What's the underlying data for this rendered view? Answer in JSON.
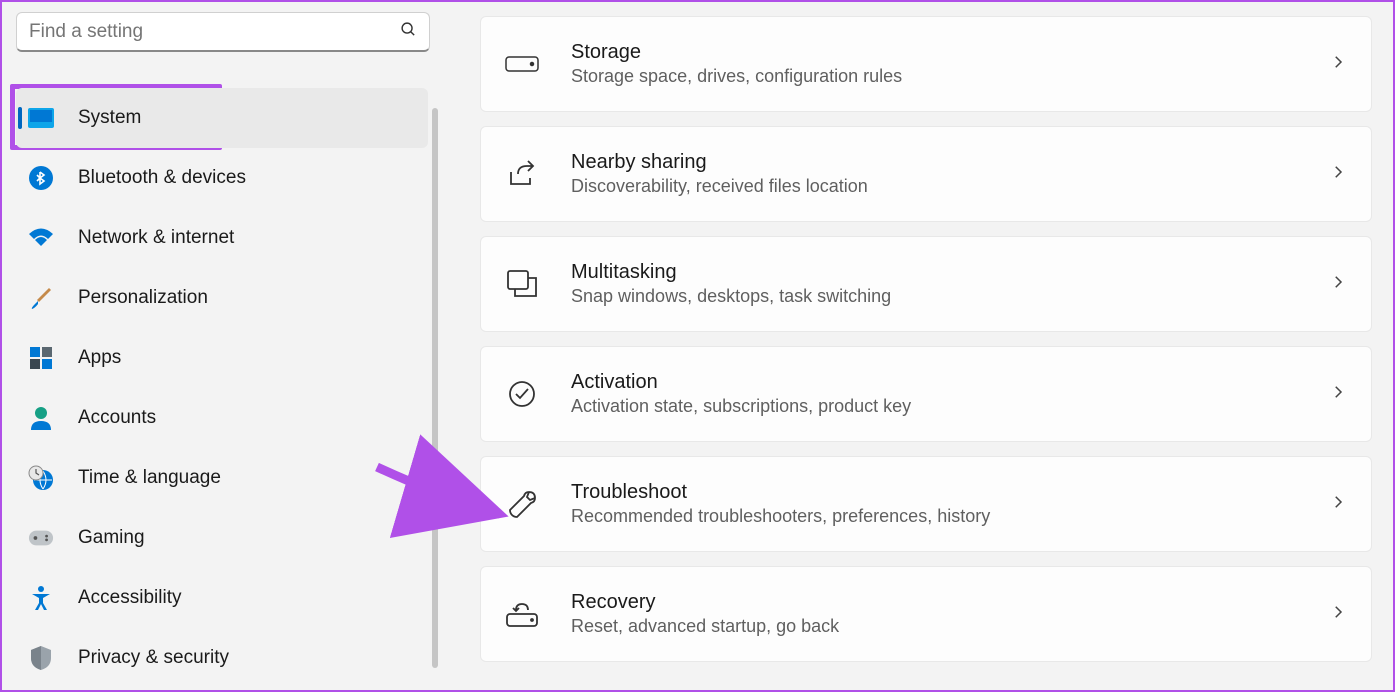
{
  "search": {
    "placeholder": "Find a setting"
  },
  "sidebar": {
    "items": [
      {
        "label": "System",
        "icon": "monitor",
        "selected": true
      },
      {
        "label": "Bluetooth & devices",
        "icon": "bluetooth"
      },
      {
        "label": "Network & internet",
        "icon": "wifi"
      },
      {
        "label": "Personalization",
        "icon": "brush"
      },
      {
        "label": "Apps",
        "icon": "apps"
      },
      {
        "label": "Accounts",
        "icon": "person"
      },
      {
        "label": "Time & language",
        "icon": "clock-globe"
      },
      {
        "label": "Gaming",
        "icon": "gamepad"
      },
      {
        "label": "Accessibility",
        "icon": "accessibility"
      },
      {
        "label": "Privacy & security",
        "icon": "shield"
      }
    ]
  },
  "cards": [
    {
      "title": "Storage",
      "sub": "Storage space, drives, configuration rules",
      "icon": "drive"
    },
    {
      "title": "Nearby sharing",
      "sub": "Discoverability, received files location",
      "icon": "share"
    },
    {
      "title": "Multitasking",
      "sub": "Snap windows, desktops, task switching",
      "icon": "windows-stack"
    },
    {
      "title": "Activation",
      "sub": "Activation state, subscriptions, product key",
      "icon": "check-circle"
    },
    {
      "title": "Troubleshoot",
      "sub": "Recommended troubleshooters, preferences, history",
      "icon": "wrench"
    },
    {
      "title": "Recovery",
      "sub": "Reset, advanced startup, go back",
      "icon": "recovery"
    }
  ],
  "annotation": {
    "highlight_item": 0,
    "arrow_target": 4
  }
}
